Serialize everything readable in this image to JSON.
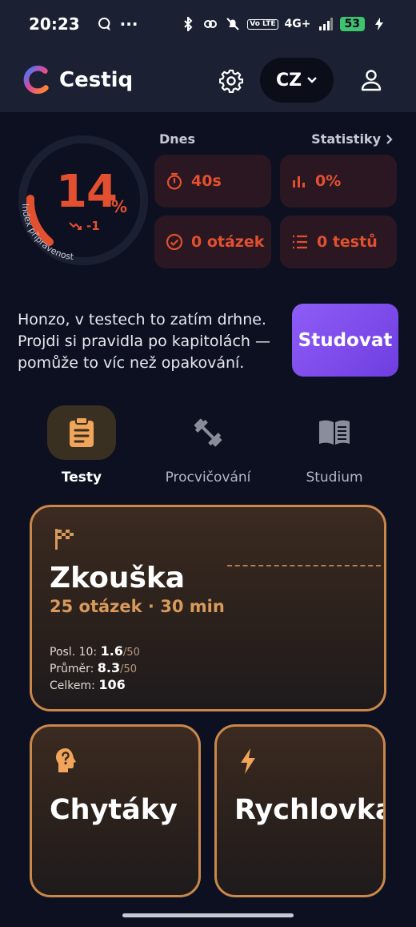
{
  "status_bar": {
    "time": "20:23",
    "overflow": "···",
    "battery": "53",
    "network": "4G+",
    "volte": "Vo LTE"
  },
  "header": {
    "brand": "Cestiq",
    "language": "CZ"
  },
  "readiness": {
    "percent": 14,
    "percent_text": "14",
    "percent_sign": "%",
    "trend": "-1",
    "label": "Index připravenosti"
  },
  "today": {
    "label": "Dnes",
    "stats_link": "Statistiky",
    "tiles": [
      {
        "icon": "timer-icon",
        "value": "40s"
      },
      {
        "icon": "bar-chart-icon",
        "value": "0%"
      },
      {
        "icon": "check-circle-icon",
        "value": "0 otázek"
      },
      {
        "icon": "list-icon",
        "value": "0 testů"
      }
    ]
  },
  "message": {
    "text": "Honzo, v testech to zatím drhne. Projdi si pravidla po kapitolách — pomůže to víc než opakování.",
    "button": "Studovat"
  },
  "tabs": [
    {
      "label": "Testy",
      "icon": "clipboard-icon",
      "active": true
    },
    {
      "label": "Procvičování",
      "icon": "dumbbell-icon",
      "active": false
    },
    {
      "label": "Studium",
      "icon": "book-icon",
      "active": false
    }
  ],
  "exam": {
    "title": "Zkouška",
    "subtitle": "25 otázek · 30 min",
    "last10_label": "Posl. 10:",
    "last10_value": "1.6",
    "average_label": "Průměr:",
    "average_value": "8.3",
    "out_of": "/50",
    "total_label": "Celkem:",
    "total_value": "106"
  },
  "modes": [
    {
      "title": "Chytáky",
      "icon": "head-question-icon"
    },
    {
      "title": "Rychlovka",
      "icon": "lightning-icon"
    }
  ],
  "colors": {
    "accent_red": "#e2502f",
    "accent_orange": "#c9874a",
    "study_purple": "#8e5cf6",
    "background": "#0d1020"
  }
}
